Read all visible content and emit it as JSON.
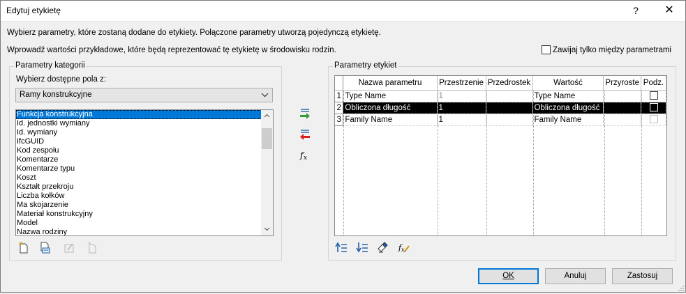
{
  "window": {
    "title": "Edytuj etykietę",
    "help_label": "?",
    "close_label": "✕"
  },
  "hints": {
    "line1": "Wybierz parametry, które zostaną dodane do etykiety. Połączone parametry utworzą pojedynczą etykietę.",
    "line2": "Wprowadź wartości przykładowe, które będą reprezentować tę etykietę w środowisku rodzin."
  },
  "wrap_checkbox": {
    "label": "Zawijaj tylko między parametrami",
    "checked": false
  },
  "category": {
    "group_title": "Parametry kategorii",
    "available_label": "Wybierz dostępne pola z:",
    "combo_value": "Ramy konstrukcyjne",
    "items": [
      "Funkcja konstrukcyjna",
      "Id. jednostki wymiany",
      "Id. wymiany",
      "IfcGUID",
      "Kod zespołu",
      "Komentarze",
      "Komentarze typu",
      "Koszt",
      "Kształt przekroju",
      "Liczba kołków",
      "Ma skojarzenie",
      "Materiał konstrukcyjny",
      "Model",
      "Nazwa rodziny"
    ],
    "selected_index": 0
  },
  "label_params": {
    "group_title": "Parametry etykiet",
    "columns": [
      "Nazwa parametru",
      "Przestrzenie",
      "Przedrostek",
      "Wartość",
      "Przyroste",
      "Podz."
    ],
    "rows": [
      {
        "num": "1",
        "name": "Type Name",
        "spaces": "1",
        "prefix": "",
        "value": "Type Name",
        "suffix": "",
        "break": false,
        "break_enabled": true,
        "spaces_dim": true
      },
      {
        "num": "2",
        "name": "Obliczona długość",
        "spaces": "1",
        "prefix": "",
        "value": "Obliczona długość",
        "suffix": "",
        "break": false,
        "break_enabled": true,
        "spaces_dim": false
      },
      {
        "num": "3",
        "name": "Family Name",
        "spaces": "1",
        "prefix": "",
        "value": "Family Name",
        "suffix": "",
        "break": false,
        "break_enabled": false,
        "spaces_dim": false
      }
    ],
    "selected_row": 1
  },
  "buttons": {
    "ok": "OK",
    "cancel": "Anuluj",
    "apply": "Zastosuj"
  },
  "colors": {
    "accent": "#0078d7",
    "green_arrow": "#3a9a3a",
    "red_arrow": "#d42020",
    "icon_blue": "#1e5ca8"
  }
}
